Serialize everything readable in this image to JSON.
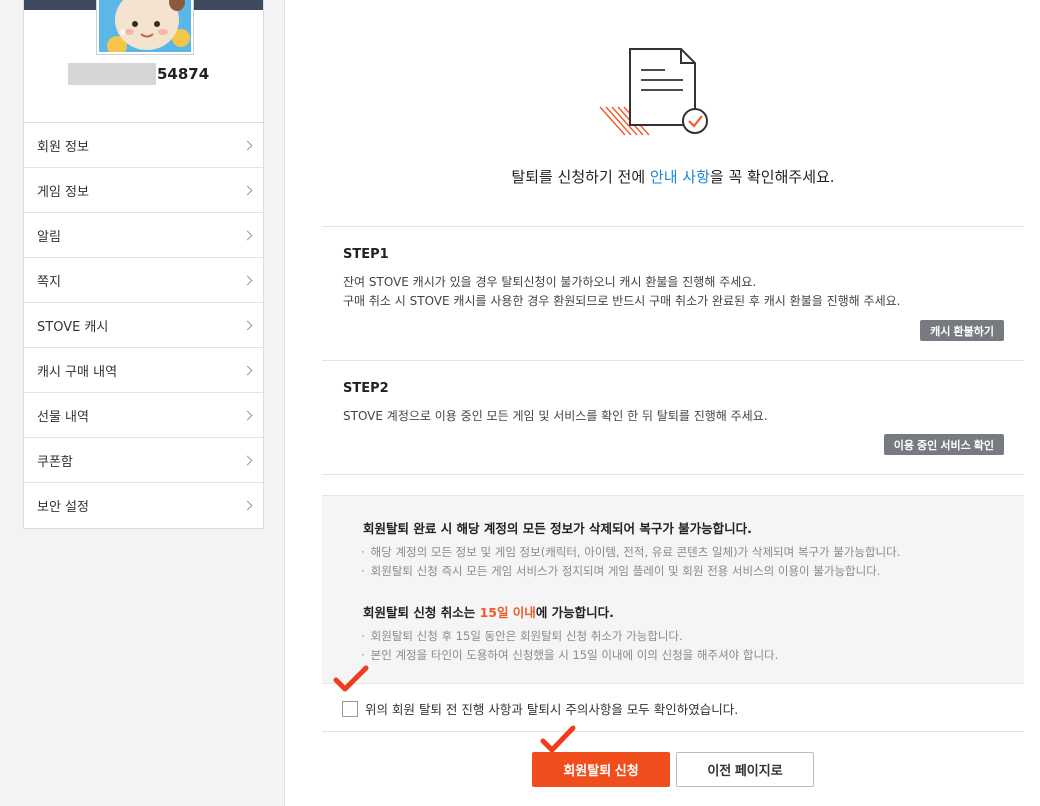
{
  "profile": {
    "user_id_visible": "54874"
  },
  "menu": {
    "items": [
      {
        "label": "회원 정보"
      },
      {
        "label": "게임 정보"
      },
      {
        "label": "알림"
      },
      {
        "label": "쪽지"
      },
      {
        "label": "STOVE 캐시"
      },
      {
        "label": "캐시 구매 내역"
      },
      {
        "label": "선물 내역"
      },
      {
        "label": "쿠폰함"
      },
      {
        "label": "보안 설정"
      }
    ]
  },
  "notice": {
    "prefix": "탈퇴를 신청하기 전에 ",
    "highlight": "안내 사항",
    "suffix": "을 꼭 확인해주세요."
  },
  "steps": [
    {
      "title": "STEP1",
      "lines": [
        "잔여 STOVE 캐시가 있을 경우 탈퇴신청이 불가하오니 캐시 환불을 진행해 주세요.",
        "구매 취소 시 STOVE 캐시를 사용한 경우 환원되므로 반드시 구매 취소가 완료된 후 캐시 환불을 진행해 주세요."
      ],
      "button": "캐시 환불하기"
    },
    {
      "title": "STEP2",
      "lines": [
        "STOVE 계정으로 이용 중인 모든 게임 및 서비스를 확인 한 뒤 탈퇴를 진행해 주세요."
      ],
      "button": "이용 중인 서비스 확인"
    }
  ],
  "warnings": {
    "heading1": "회원탈퇴 완료 시 해당 계정의 모든 정보가 삭제되어 복구가 불가능합니다.",
    "items1": [
      "해당 계정의 모든 정보 및 게임 정보(캐릭터, 아이템, 전적, 유료 콘텐츠 일체)가 삭제되며 복구가 불가능합니다.",
      "회원탈퇴 신청 즉시 모든 게임 서비스가 정지되며 게임 플레이 및 회원 전용 서비스의 이용이 불가능합니다."
    ],
    "heading2_prefix": "회원탈퇴 신청 취소는 ",
    "heading2_highlight": "15일 이내",
    "heading2_suffix": "에 가능합니다.",
    "items2": [
      "회원탈퇴 신청 후 15일 동안은 회원탈퇴 신청 취소가 가능합니다.",
      "본인 계정을 타인이 도용하여 신청했을 시 15일 이내에 이의 신청을 해주셔야 합니다."
    ]
  },
  "agreement": {
    "label": "위의 회원 탈퇴 전 진행 사항과 탈퇴시 주의사항을 모두 확인하였습니다.",
    "checked": false
  },
  "actions": {
    "submit": "회원탈퇴 신청",
    "back": "이전 페이지로"
  },
  "colors": {
    "accent": "#f04f1d",
    "link": "#1f86d4",
    "annotation_check": "#f03c1c"
  }
}
